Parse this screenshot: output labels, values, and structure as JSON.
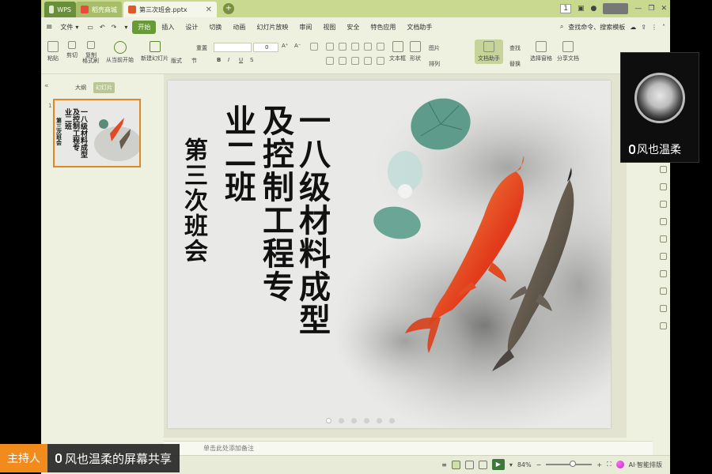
{
  "tabs": [
    {
      "label": "WPS"
    },
    {
      "label": "稻壳商城"
    },
    {
      "label": "第三次班会.pptx"
    }
  ],
  "window": {
    "page_indicator": "1"
  },
  "menu": {
    "file": "文件",
    "items": [
      "开始",
      "插入",
      "设计",
      "切换",
      "动画",
      "幻灯片放映",
      "审阅",
      "视图",
      "安全",
      "特色应用",
      "文档助手"
    ],
    "active_index": 0,
    "search_placeholder": "查找命令、搜索模板"
  },
  "ribbon": {
    "paste": "粘贴",
    "cut": "剪切",
    "copy": "复制",
    "format_painter": "格式刷",
    "from_current": "从当前开始",
    "new_slide": "新建幻灯片",
    "layout": "版式",
    "section": "节",
    "reset": "重置",
    "font_size": "0",
    "textbox": "文本框",
    "shape": "形状",
    "arrange": "排列",
    "picture": "图片",
    "find": "查找",
    "replace": "替换",
    "doc_helper": "文档助手",
    "select_window": "选择窗格",
    "share_doc": "分享文档"
  },
  "left_panel": {
    "tab_outline": "大纲",
    "tab_slides": "幻灯片",
    "slide_number": "1"
  },
  "slide": {
    "col1": "一八级材料成型",
    "col2": "及控制工程专",
    "col3": "业二班",
    "col4": "第三次班会"
  },
  "notes": {
    "placeholder": "单击此处添加备注"
  },
  "status": {
    "zoom": "84%",
    "ai_label": "AI·智能排版"
  },
  "camera": {
    "name": "风也温柔"
  },
  "host": {
    "label": "主持人",
    "name": "风也温柔的屏幕共享"
  }
}
